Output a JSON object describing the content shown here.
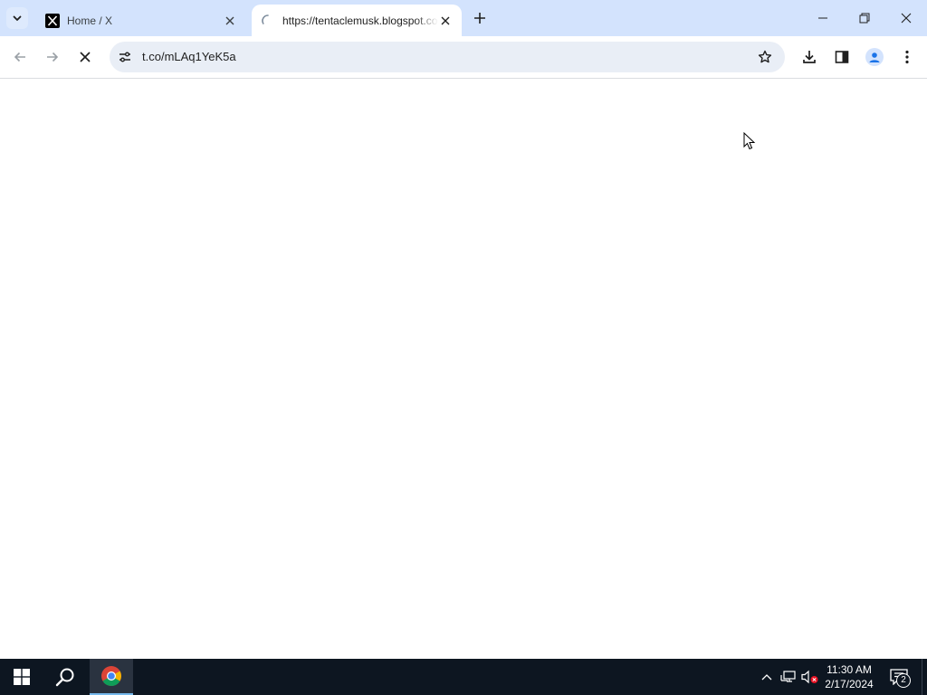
{
  "browser": {
    "tabs": [
      {
        "title": "Home / X",
        "favicon": "x-logo-icon",
        "active": false
      },
      {
        "title": "https://tentaclemusk.blogspot.com",
        "favicon": "loading-spinner-icon",
        "active": true
      }
    ],
    "url": "t.co/mLAq1YeK5a",
    "accent_color": "#d3e3fd"
  },
  "taskbar": {
    "time": "11:30 AM",
    "date": "2/17/2024",
    "notification_count": "2"
  }
}
